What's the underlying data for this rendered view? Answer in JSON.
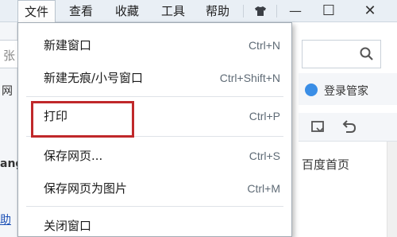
{
  "menubar": {
    "items": [
      {
        "label": "文件",
        "active": true
      },
      {
        "label": "查看",
        "active": false
      },
      {
        "label": "收藏",
        "active": false
      },
      {
        "label": "工具",
        "active": false
      },
      {
        "label": "帮助",
        "active": false
      }
    ],
    "skin_icon": "shirt-icon",
    "minimize": "—",
    "maximize": "☐",
    "close": "✕"
  },
  "background": {
    "addr_text": "张",
    "row_text": "网",
    "login_label": "登录管家",
    "home_link": "百度首页",
    "left_text": "ang",
    "left_link": "助"
  },
  "file_menu": {
    "items": [
      {
        "label": "新建窗口",
        "shortcut": "Ctrl+N"
      },
      {
        "label": "新建无痕/小号窗口",
        "shortcut": "Ctrl+Shift+N"
      },
      {
        "label": "打印",
        "shortcut": "Ctrl+P",
        "highlighted": true
      },
      {
        "label": "保存网页...",
        "shortcut": "Ctrl+S"
      },
      {
        "label": "保存网页为图片",
        "shortcut": "Ctrl+M"
      },
      {
        "label": "关闭窗口",
        "shortcut": ""
      }
    ]
  },
  "colors": {
    "highlight_box": "#c0282a",
    "link": "#1a4fb5"
  }
}
